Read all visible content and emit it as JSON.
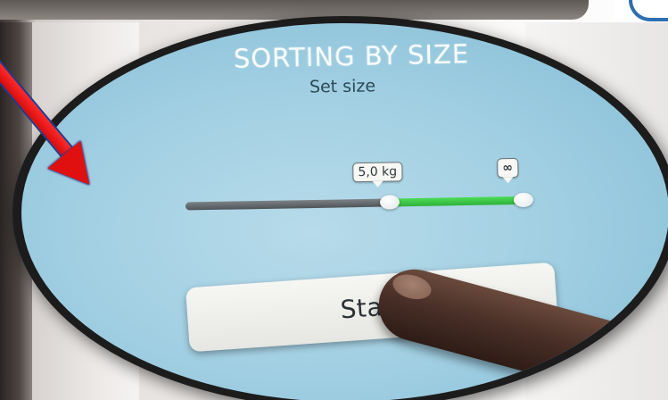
{
  "screen": {
    "title": "SORTING BY SIZE",
    "subtitle": "Set size"
  },
  "size_slider": {
    "min_label": "5,0 kg",
    "max_label": "∞",
    "track_color": "#5b6164",
    "range_color": "#3ac845"
  },
  "start_button": {
    "label": "Start sorting",
    "visible_label": "Start"
  },
  "annotation": {
    "arrow_color": "#e01010",
    "zoom_frame_color": "#1c1c1c",
    "screen_color": "#a3d0e3"
  }
}
